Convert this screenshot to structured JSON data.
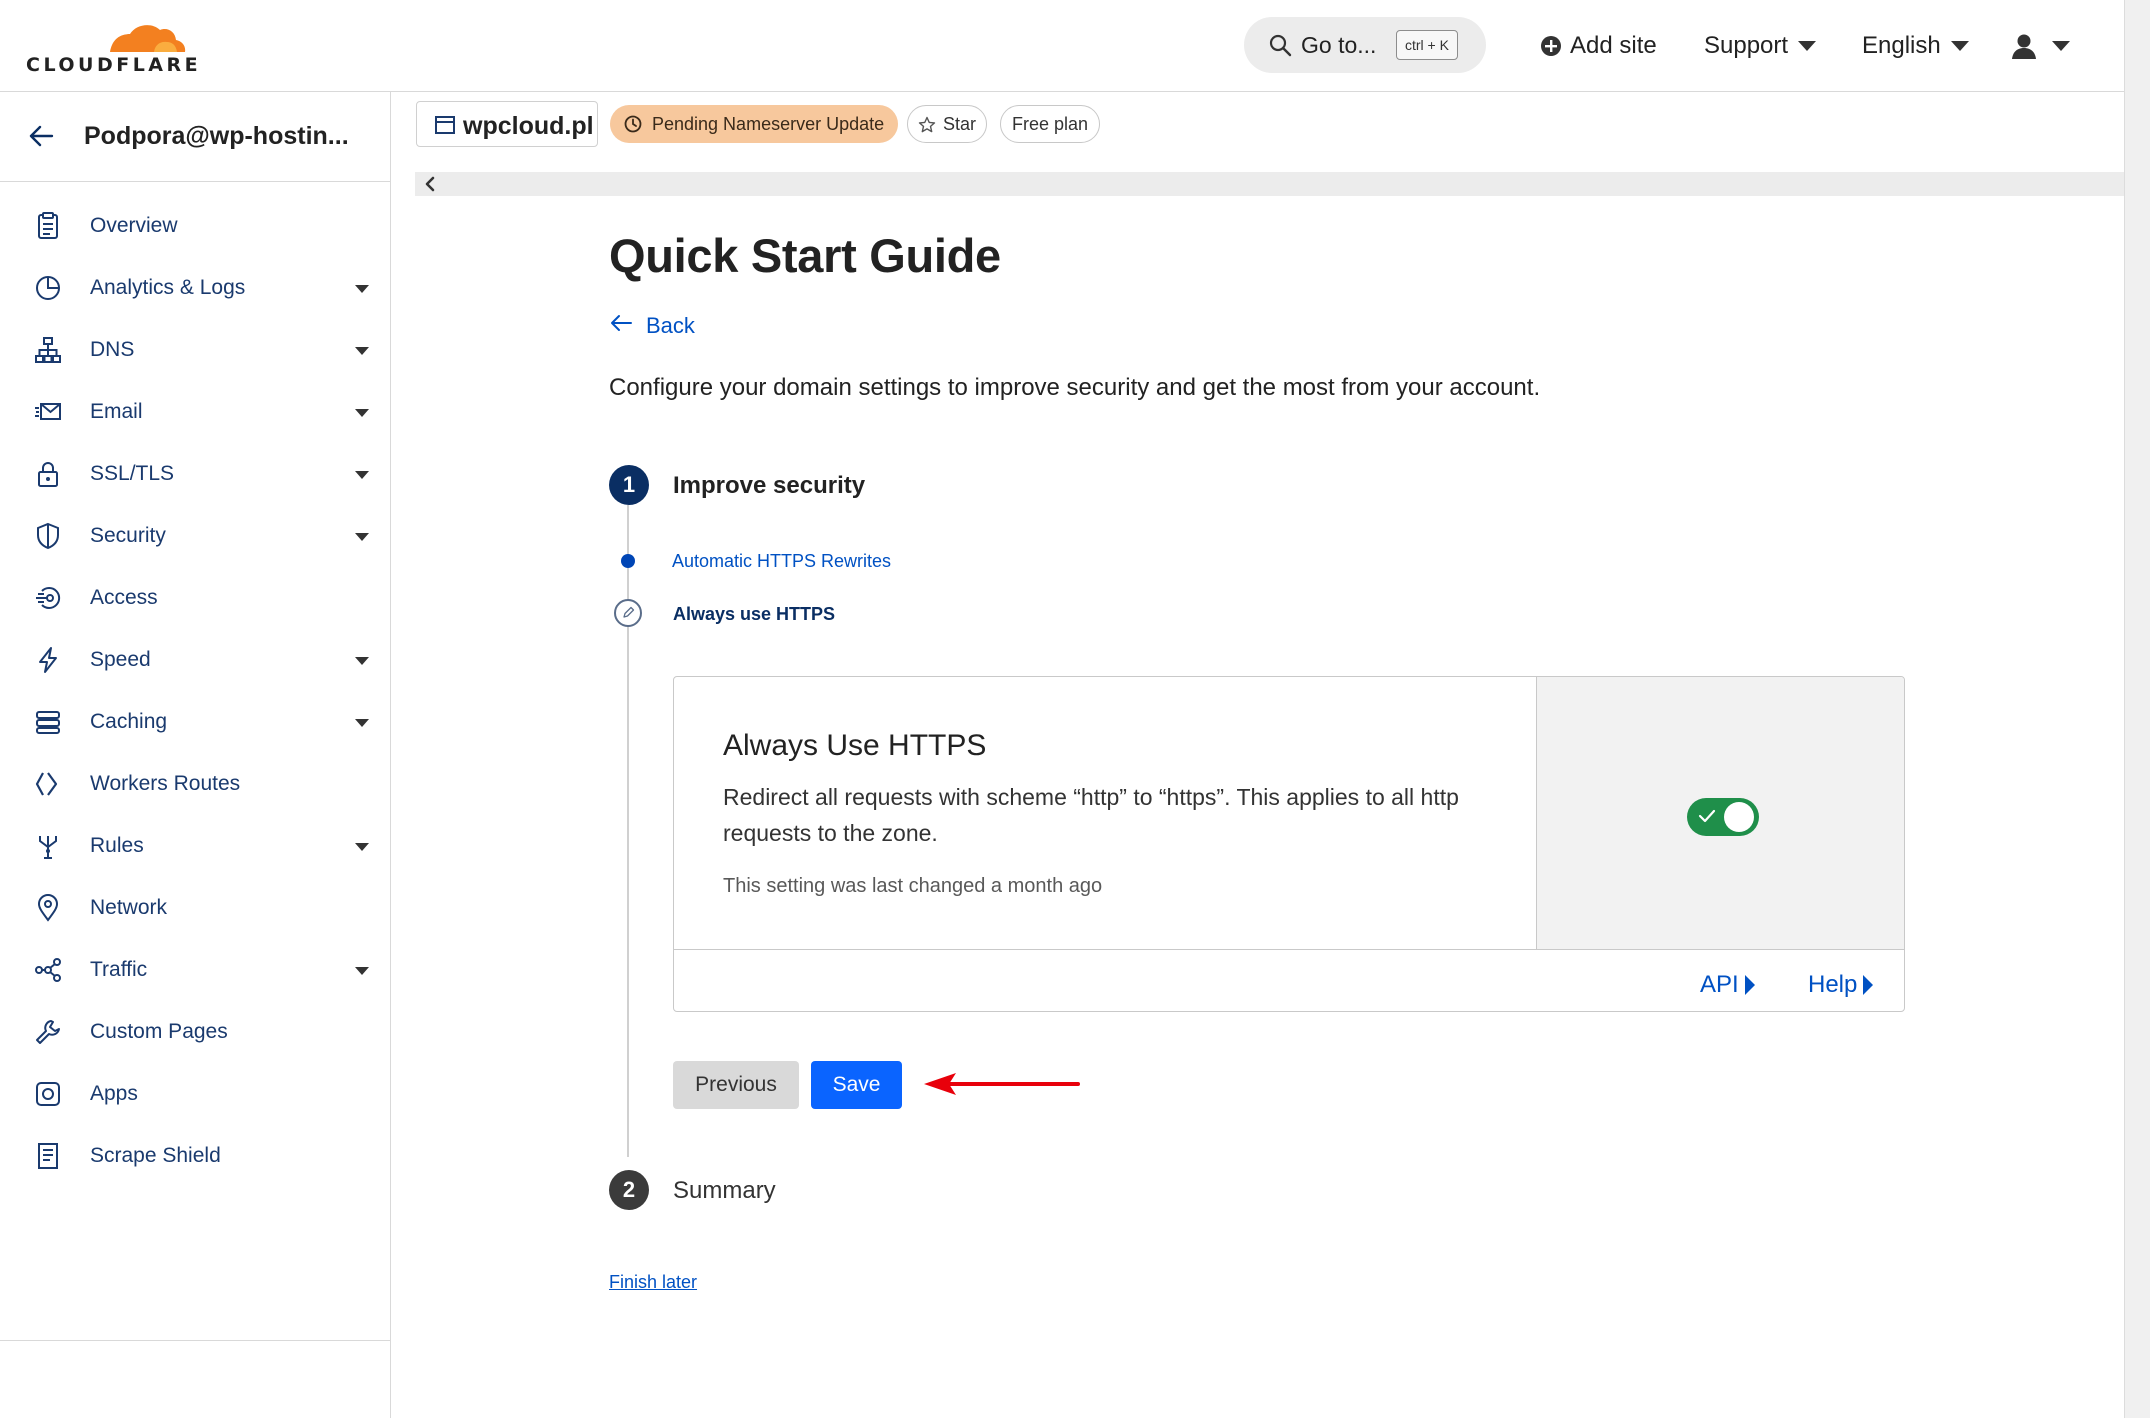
{
  "brand": {
    "name": "CLOUDFLARE",
    "accent": "#f38020"
  },
  "header": {
    "search_label": "Go to...",
    "search_shortcut": "ctrl + K",
    "add_site": "Add site",
    "support": "Support",
    "language": "English"
  },
  "sidebar": {
    "account": "Podpora@wp-hostin...",
    "items": [
      {
        "label": "Overview",
        "icon": "clipboard-icon",
        "expandable": false
      },
      {
        "label": "Analytics & Logs",
        "icon": "pie-chart-icon",
        "expandable": true
      },
      {
        "label": "DNS",
        "icon": "network-tree-icon",
        "expandable": true
      },
      {
        "label": "Email",
        "icon": "email-icon",
        "expandable": true
      },
      {
        "label": "SSL/TLS",
        "icon": "lock-icon",
        "expandable": true
      },
      {
        "label": "Security",
        "icon": "shield-icon",
        "expandable": true
      },
      {
        "label": "Access",
        "icon": "access-icon",
        "expandable": false
      },
      {
        "label": "Speed",
        "icon": "lightning-icon",
        "expandable": true
      },
      {
        "label": "Caching",
        "icon": "server-stack-icon",
        "expandable": true
      },
      {
        "label": "Workers Routes",
        "icon": "workers-icon",
        "expandable": false
      },
      {
        "label": "Rules",
        "icon": "rules-fork-icon",
        "expandable": true
      },
      {
        "label": "Network",
        "icon": "location-pin-icon",
        "expandable": false
      },
      {
        "label": "Traffic",
        "icon": "traffic-icon",
        "expandable": true
      },
      {
        "label": "Custom Pages",
        "icon": "wrench-icon",
        "expandable": false
      },
      {
        "label": "Apps",
        "icon": "apps-icon",
        "expandable": false
      },
      {
        "label": "Scrape Shield",
        "icon": "document-icon",
        "expandable": false
      }
    ]
  },
  "zone": {
    "domain": "wpcloud.pl",
    "status": "Pending Nameserver Update",
    "star": "Star",
    "plan": "Free plan",
    "status_color": "#f7c89d"
  },
  "main": {
    "title": "Quick Start Guide",
    "back": "Back",
    "intro": "Configure your domain settings to improve security and get the most from your account.",
    "steps": [
      {
        "number": "1",
        "title": "Improve security",
        "state": "active"
      },
      {
        "number": "2",
        "title": "Summary",
        "state": "pending"
      }
    ],
    "substeps": [
      {
        "label": "Automatic HTTPS Rewrites",
        "state": "done"
      },
      {
        "label": "Always use HTTPS",
        "state": "current"
      }
    ],
    "card": {
      "title": "Always Use HTTPS",
      "description": "Redirect all requests with scheme “http” to “https”. This applies to all http requests to the zone.",
      "note": "This setting was last changed a month ago",
      "toggle_on": true,
      "api_link": "API",
      "help_link": "Help"
    },
    "buttons": {
      "previous": "Previous",
      "save": "Save"
    },
    "finish_later": "Finish later"
  },
  "colors": {
    "primary": "#0a64ff",
    "link": "#0051c3",
    "toggle_on": "#1f8f4a",
    "step_active": "#0a2e63",
    "annotation_arrow": "#e8000b"
  }
}
